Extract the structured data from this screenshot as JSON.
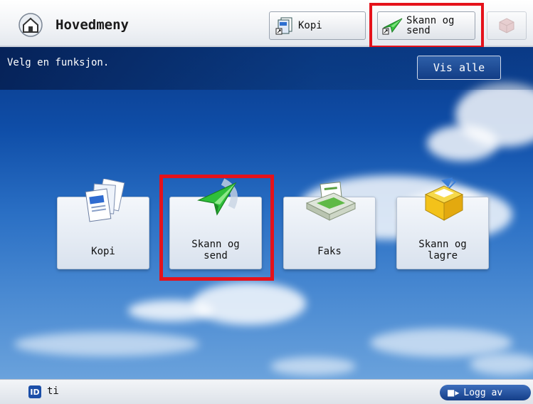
{
  "header": {
    "title": "Hovedmeny",
    "shortcut_kopi_label": "Kopi",
    "shortcut_skann_label_line1": "Skann og",
    "shortcut_skann_label_line2": "send"
  },
  "status": {
    "instruction": "Velg en funksjon.",
    "show_all_label": "Vis alle"
  },
  "functions": {
    "kopi": {
      "label": "Kopi"
    },
    "skann_og_send": {
      "line1": "Skann og",
      "line2": "send"
    },
    "faks": {
      "label": "Faks"
    },
    "skann_og_lagre": {
      "line1": "Skann og",
      "line2": "lagre"
    }
  },
  "footer": {
    "id_badge": "ID",
    "user": "ti",
    "logout_label": "Logg av"
  },
  "colors": {
    "highlight": "#e5121b",
    "accent_blue": "#1c4fa8",
    "send_green": "#2fbf3a"
  },
  "icons": [
    "home-icon",
    "copy-icon",
    "scan-send-icon",
    "cube-icon",
    "fax-icon",
    "scan-store-icon",
    "id-icon",
    "logout-arrow-icon"
  ]
}
